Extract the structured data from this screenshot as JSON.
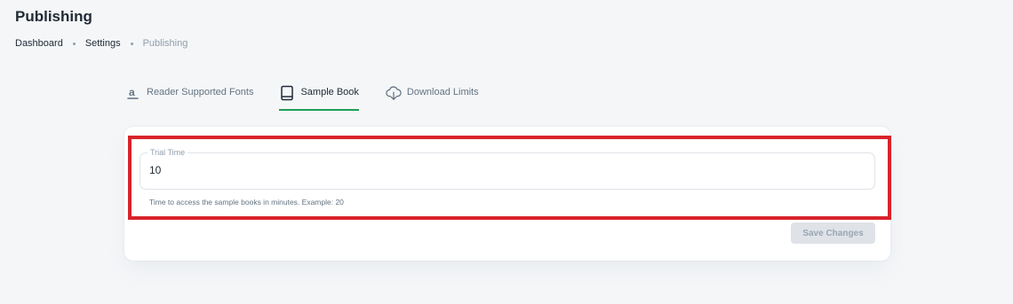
{
  "header": {
    "title": "Publishing"
  },
  "breadcrumb": {
    "items": [
      "Dashboard",
      "Settings",
      "Publishing"
    ]
  },
  "tabs": [
    {
      "label": "Reader Supported Fonts",
      "icon": "amazon-a-icon",
      "active": false
    },
    {
      "label": "Sample Book",
      "icon": "book-icon",
      "active": true
    },
    {
      "label": "Download Limits",
      "icon": "cloud-download-icon",
      "active": false
    }
  ],
  "form": {
    "trial_time": {
      "label": "Trial Time",
      "value": "10",
      "helper": "Time to access the sample books in minutes. Example: 20"
    },
    "save_label": "Save Changes",
    "save_disabled": true
  },
  "colors": {
    "background": "#f4f6f8",
    "accent": "#1f9d55",
    "highlight": "#d8232a"
  }
}
